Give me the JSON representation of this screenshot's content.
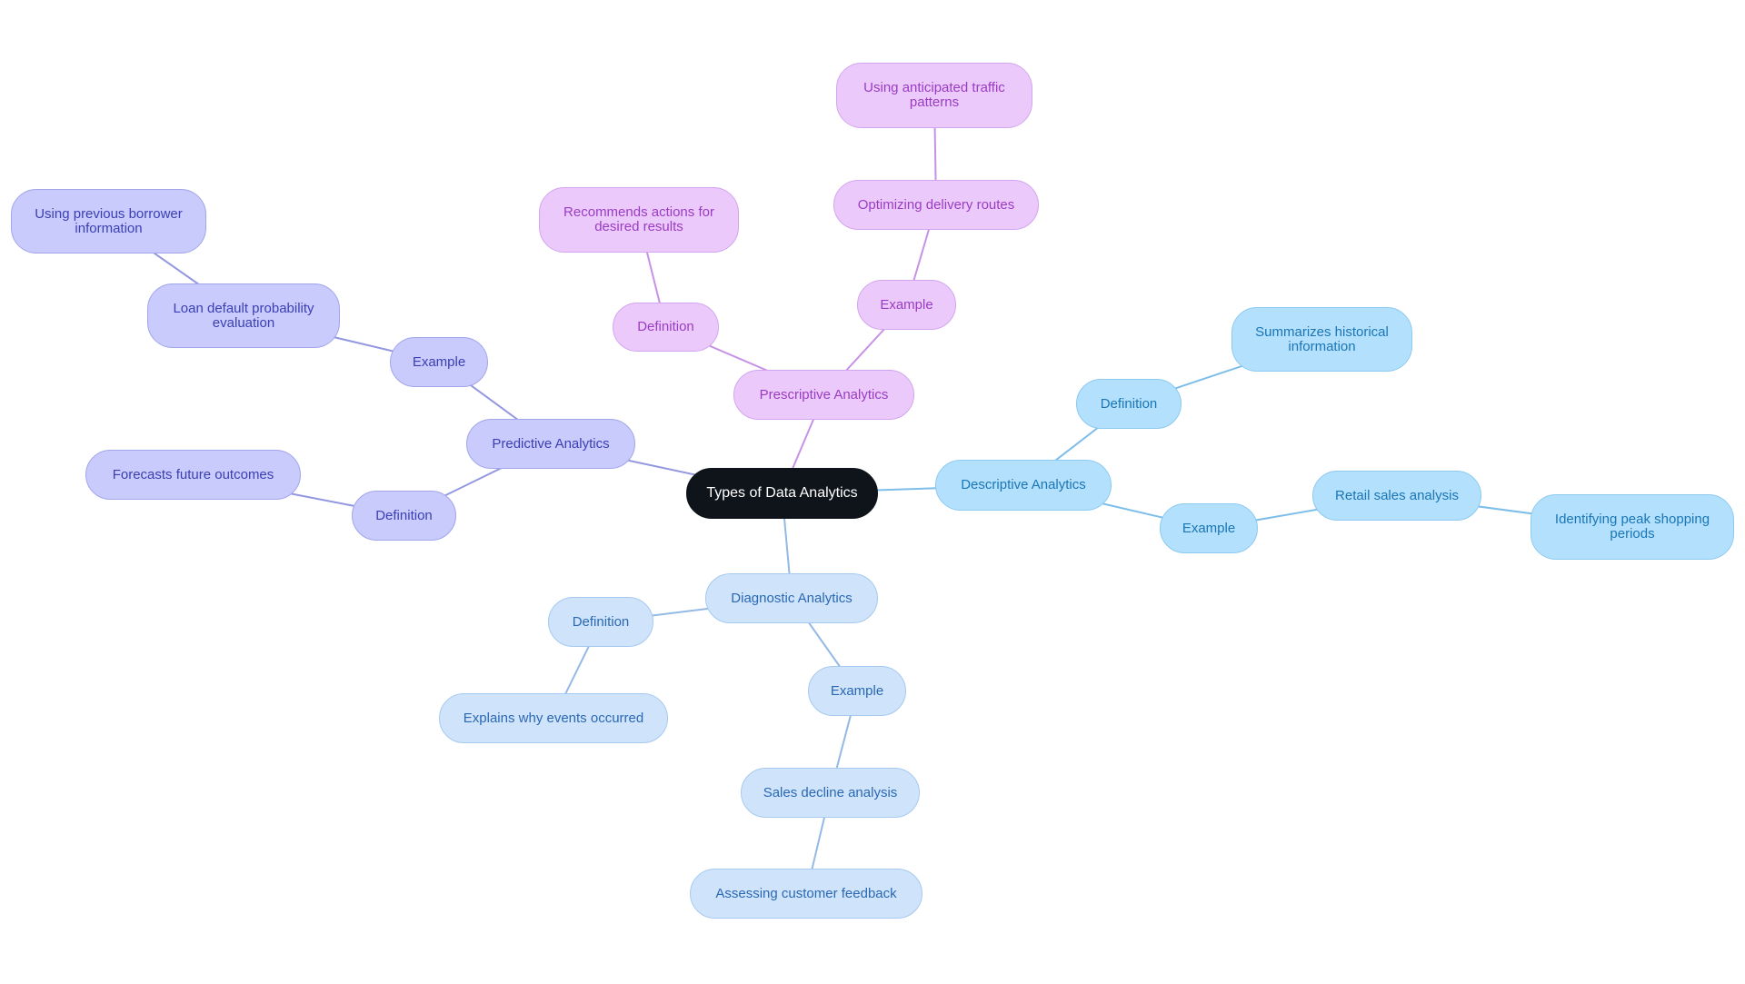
{
  "title": "Types of Data Analytics",
  "colors": {
    "descriptive_edge": "#7cbde9",
    "diagnostic_edge": "#93b9e6",
    "predictive_edge": "#9297e0",
    "prescriptive_edge": "#c792e6"
  },
  "nodes": {
    "root": {
      "label": "Types of Data Analytics"
    },
    "descriptive": {
      "label": "Descriptive Analytics"
    },
    "descriptive_definition": {
      "label": "Definition"
    },
    "descriptive_definition_text": {
      "label": "Summarizes historical information"
    },
    "descriptive_example": {
      "label": "Example"
    },
    "descriptive_example_text": {
      "label": "Retail sales analysis"
    },
    "descriptive_example_detail": {
      "label": "Identifying peak shopping periods"
    },
    "diagnostic": {
      "label": "Diagnostic Analytics"
    },
    "diagnostic_definition": {
      "label": "Definition"
    },
    "diagnostic_definition_text": {
      "label": "Explains why events occurred"
    },
    "diagnostic_example": {
      "label": "Example"
    },
    "diagnostic_example_text": {
      "label": "Sales decline analysis"
    },
    "diagnostic_example_detail": {
      "label": "Assessing customer feedback"
    },
    "predictive": {
      "label": "Predictive Analytics"
    },
    "predictive_definition": {
      "label": "Definition"
    },
    "predictive_definition_text": {
      "label": "Forecasts future outcomes"
    },
    "predictive_example": {
      "label": "Example"
    },
    "predictive_example_text": {
      "label": "Loan default probability evaluation"
    },
    "predictive_example_detail": {
      "label": "Using previous borrower information"
    },
    "prescriptive": {
      "label": "Prescriptive Analytics"
    },
    "prescriptive_definition": {
      "label": "Definition"
    },
    "prescriptive_definition_text": {
      "label": "Recommends actions for desired results"
    },
    "prescriptive_example": {
      "label": "Example"
    },
    "prescriptive_example_text": {
      "label": "Optimizing delivery routes"
    },
    "prescriptive_example_detail": {
      "label": "Using anticipated traffic patterns"
    }
  },
  "edges": [
    [
      "root",
      "descriptive",
      "descriptive_edge"
    ],
    [
      "descriptive",
      "descriptive_definition",
      "descriptive_edge"
    ],
    [
      "descriptive_definition",
      "descriptive_definition_text",
      "descriptive_edge"
    ],
    [
      "descriptive",
      "descriptive_example",
      "descriptive_edge"
    ],
    [
      "descriptive_example",
      "descriptive_example_text",
      "descriptive_edge"
    ],
    [
      "descriptive_example_text",
      "descriptive_example_detail",
      "descriptive_edge"
    ],
    [
      "root",
      "diagnostic",
      "diagnostic_edge"
    ],
    [
      "diagnostic",
      "diagnostic_definition",
      "diagnostic_edge"
    ],
    [
      "diagnostic_definition",
      "diagnostic_definition_text",
      "diagnostic_edge"
    ],
    [
      "diagnostic",
      "diagnostic_example",
      "diagnostic_edge"
    ],
    [
      "diagnostic_example",
      "diagnostic_example_text",
      "diagnostic_edge"
    ],
    [
      "diagnostic_example_text",
      "diagnostic_example_detail",
      "diagnostic_edge"
    ],
    [
      "root",
      "predictive",
      "predictive_edge"
    ],
    [
      "predictive",
      "predictive_definition",
      "predictive_edge"
    ],
    [
      "predictive_definition",
      "predictive_definition_text",
      "predictive_edge"
    ],
    [
      "predictive",
      "predictive_example",
      "predictive_edge"
    ],
    [
      "predictive_example",
      "predictive_example_text",
      "predictive_edge"
    ],
    [
      "predictive_example_text",
      "predictive_example_detail",
      "predictive_edge"
    ],
    [
      "root",
      "prescriptive",
      "prescriptive_edge"
    ],
    [
      "prescriptive",
      "prescriptive_definition",
      "prescriptive_edge"
    ],
    [
      "prescriptive_definition",
      "prescriptive_definition_text",
      "prescriptive_edge"
    ],
    [
      "prescriptive",
      "prescriptive_example",
      "prescriptive_edge"
    ],
    [
      "prescriptive_example",
      "prescriptive_example_text",
      "prescriptive_edge"
    ],
    [
      "prescriptive_example_text",
      "prescriptive_example_detail",
      "prescriptive_edge"
    ]
  ]
}
